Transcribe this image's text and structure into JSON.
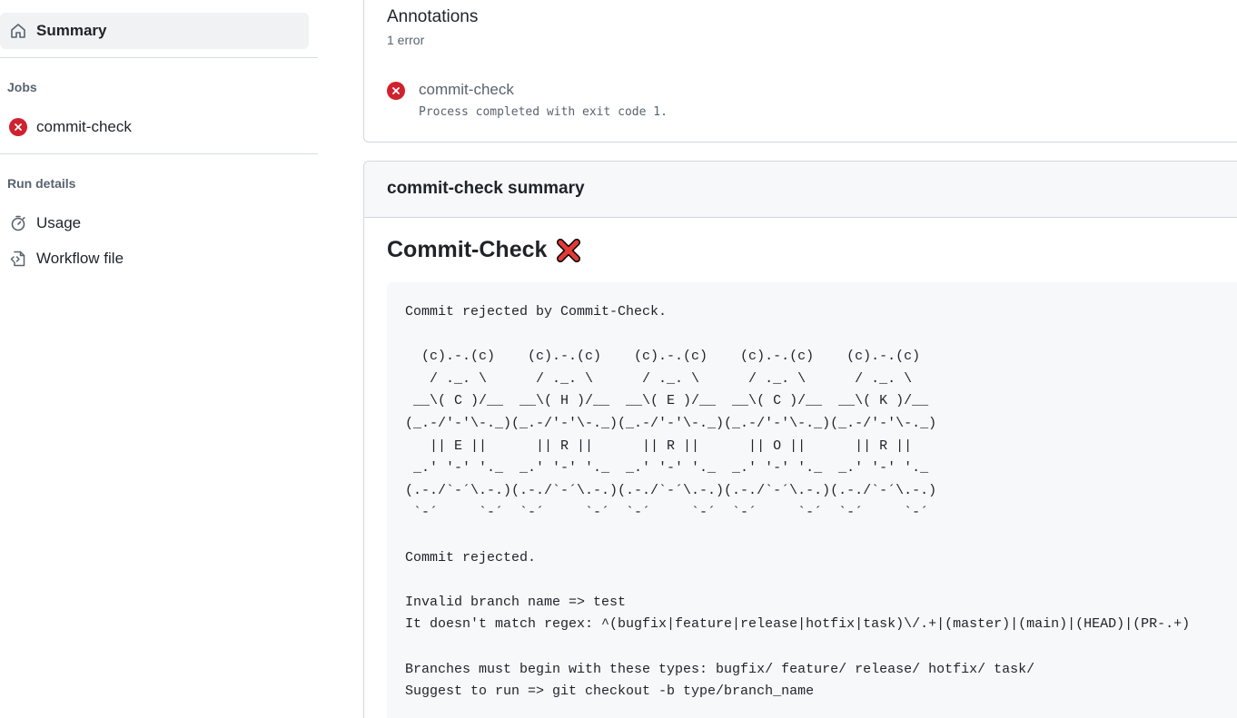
{
  "sidebar": {
    "summary_label": "Summary",
    "jobs_title": "Jobs",
    "jobs": [
      {
        "label": "commit-check",
        "status": "error"
      }
    ],
    "run_details_title": "Run details",
    "run_details": [
      {
        "label": "Usage",
        "icon": "stopwatch-icon"
      },
      {
        "label": "Workflow file",
        "icon": "file-code-icon"
      }
    ]
  },
  "annotations": {
    "title": "Annotations",
    "count_text": "1 error",
    "items": [
      {
        "job": "commit-check",
        "message": "Process completed with exit code 1.",
        "status": "error"
      }
    ]
  },
  "summary": {
    "card_title": "commit-check summary",
    "heading": "Commit-Check",
    "heading_icon": "x-mark-emoji",
    "code_lines": [
      "Commit rejected by Commit-Check.",
      "",
      "  (c).-.(c)    (c).-.(c)    (c).-.(c)    (c).-.(c)    (c).-.(c)",
      "   / ._. \\      / ._. \\      / ._. \\      / ._. \\      / ._. \\",
      " __\\( C )/__  __\\( H )/__  __\\( E )/__  __\\( C )/__  __\\( K )/__",
      "(_.-/'-'\\-._)(_.-/'-'\\-._)(_.-/'-'\\-._)(_.-/'-'\\-._)(_.-/'-'\\-._)",
      "   || E ||      || R ||      || R ||      || O ||      || R ||",
      " _.' '-' '._  _.' '-' '._  _.' '-' '._  _.' '-' '._  _.' '-' '._",
      "(.-./`-´\\.-.)(.-./`-´\\.-.)(.-./`-´\\.-.)(.-./`-´\\.-.)(.-./`-´\\.-.)",
      " `-´     `-´  `-´     `-´  `-´     `-´  `-´     `-´  `-´     `-´",
      "",
      "Commit rejected.",
      "",
      "Invalid branch name => test",
      "It doesn't match regex: ^(bugfix|feature|release|hotfix|task)\\/.+|(master)|(main)|(HEAD)|(PR-.+)",
      "",
      "Branches must begin with these types: bugfix/ feature/ release/ hotfix/ task/",
      "Suggest to run => git checkout -b type/branch_name"
    ]
  },
  "colors": {
    "error": "#cf222e",
    "muted": "#59636e",
    "border": "#d1d9e0",
    "panel": "#f6f8fa",
    "selected_nav": "#f0f2f4"
  }
}
